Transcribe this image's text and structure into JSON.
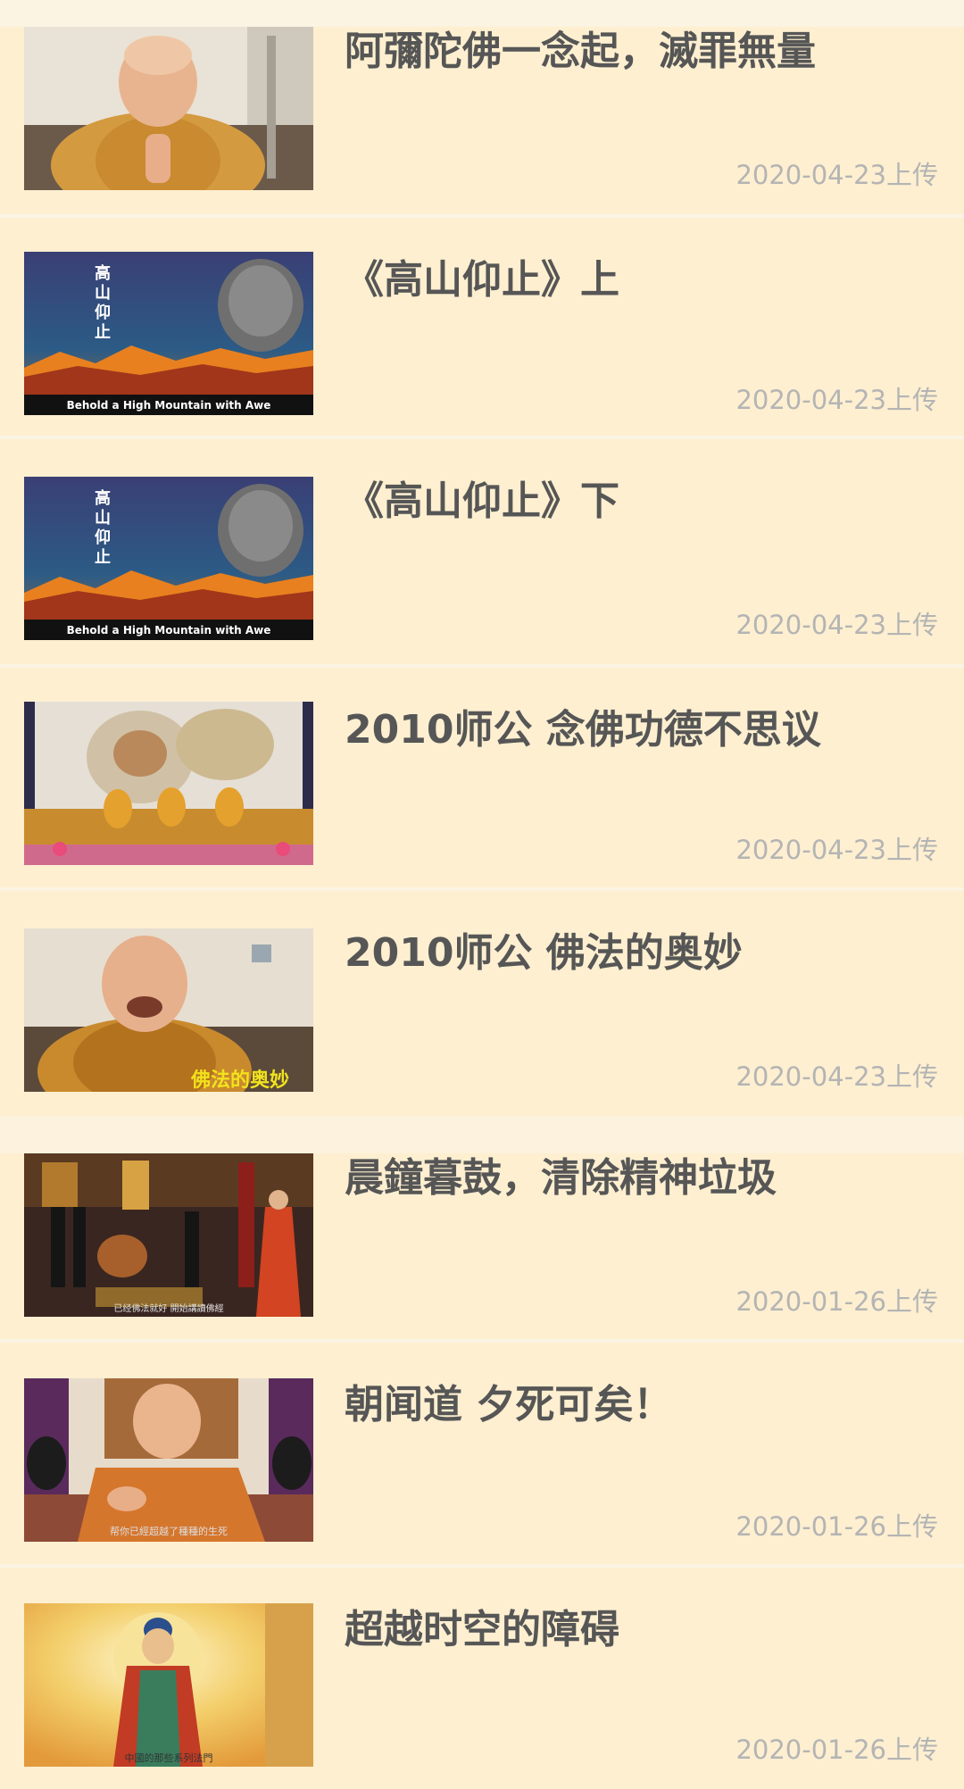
{
  "videos": [
    {
      "title": "阿彌陀佛一念起，滅罪無量",
      "date": "2020-04-23上传",
      "thumb": "monk-portrait-icon"
    },
    {
      "title": "《高山仰止》上",
      "date": "2020-04-23上传",
      "thumb": "mountain-poster-icon",
      "overlay": "Behold a High Mountain with Awe",
      "vertical": "高山仰止"
    },
    {
      "title": "《高山仰止》下",
      "date": "2020-04-23上传",
      "thumb": "mountain-poster-icon",
      "overlay": "Behold a High Mountain with Awe",
      "vertical": "高山仰止"
    },
    {
      "title": "2010师公 念佛功德不思议",
      "date": "2020-04-23上传",
      "thumb": "stage-lion-icon"
    },
    {
      "title": "2010师公 佛法的奥妙",
      "date": "2020-04-23上传",
      "thumb": "monk-laughing-icon",
      "overlay": "佛法的奥妙"
    },
    {
      "title": "晨鐘暮鼓，清除精神垃圾",
      "date": "2020-01-26上传",
      "thumb": "temple-hall-icon",
      "overlay": "已经佛法就好 開始講讀佛經"
    },
    {
      "title": "朝闻道 夕死可矣！",
      "date": "2020-01-26上传",
      "thumb": "monk-teaching-icon",
      "overlay": "帮你已經超越了種種的生死"
    },
    {
      "title": "超越时空的障碍",
      "date": "2020-01-26上传",
      "thumb": "buddha-painting-icon",
      "overlay": "中國的那些系列法門"
    }
  ],
  "colors": {
    "background": "#fdefd0",
    "title": "#565656",
    "date": "#b4b4b4"
  }
}
